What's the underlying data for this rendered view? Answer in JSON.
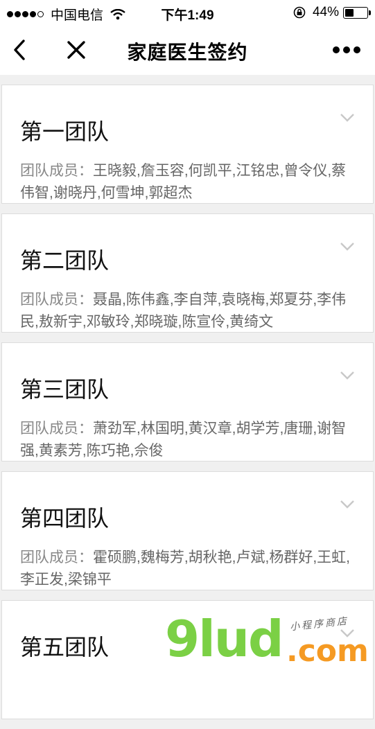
{
  "status_bar": {
    "carrier": "中国电信",
    "time": "下午1:49",
    "battery_text": "44%",
    "battery_level": 0.44
  },
  "nav": {
    "title": "家庭医生签约"
  },
  "teams": [
    {
      "name": "第一团队",
      "members_label": "团队成员：",
      "members": "王晓毅,詹玉容,何凯平,江铭忠,曾令仪,蔡伟智,谢晓丹,何雪坤,郭超杰"
    },
    {
      "name": "第二团队",
      "members_label": "团队成员：",
      "members": "聂晶,陈伟鑫,李自萍,袁晓梅,郑夏芬,李伟民,敖新宇,邓敏玲,郑晓璇,陈宣伶,黄绮文"
    },
    {
      "name": "第三团队",
      "members_label": "团队成员：",
      "members": "萧劲军,林国明,黄汉章,胡学芳,唐珊,谢智强,黄素芳,陈巧艳,佘俊"
    },
    {
      "name": "第四团队",
      "members_label": "团队成员：",
      "members": "霍硕鹏,魏梅芳,胡秋艳,卢斌,杨群好,王虹,李正发,梁锦平"
    },
    {
      "name": "第五团队",
      "members_label": "",
      "members": ""
    }
  ],
  "watermark": {
    "brand": "9lud",
    "domain": ".com",
    "tagline": "小程序商店"
  },
  "colors": {
    "watermark_green": "#7bd045",
    "watermark_orange": "#f59a23"
  }
}
